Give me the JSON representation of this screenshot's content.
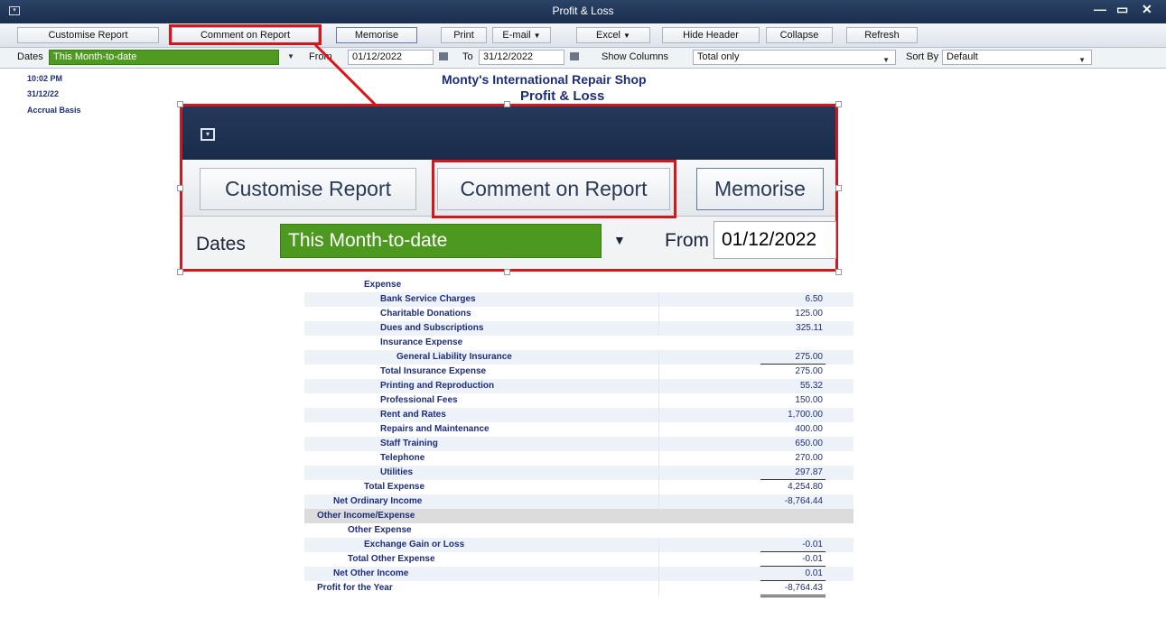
{
  "window": {
    "title": "Profit & Loss",
    "controls": [
      "—",
      "▭",
      "✕"
    ]
  },
  "toolbar": {
    "customise": "Customise Report",
    "comment": "Comment on Report",
    "memorise": "Memorise",
    "print": "Print",
    "email": "E-mail",
    "excel": "Excel",
    "hide_header": "Hide Header",
    "collapse": "Collapse",
    "refresh": "Refresh"
  },
  "filters": {
    "dates_label": "Dates",
    "dates_value": "This Month-to-date",
    "from_label": "From",
    "from_value": "01/12/2022",
    "to_label": "To",
    "to_value": "31/12/2022",
    "show_columns_label": "Show Columns",
    "show_columns_value": "Total only",
    "sort_by_label": "Sort By",
    "sort_by_value": "Default"
  },
  "report": {
    "time": "10:02 PM",
    "date": "31/12/22",
    "basis": "Accrual Basis",
    "company": "Monty's International Repair Shop",
    "title": "Profit & Loss"
  },
  "rows": [
    {
      "label": "Expense",
      "amount": ""
    },
    {
      "label": "Bank Service Charges",
      "amount": "6.50"
    },
    {
      "label": "Charitable Donations",
      "amount": "125.00"
    },
    {
      "label": "Dues and Subscriptions",
      "amount": "325.11"
    },
    {
      "label": "Insurance Expense",
      "amount": ""
    },
    {
      "label": "General Liability Insurance",
      "amount": "275.00"
    },
    {
      "label": "Total Insurance Expense",
      "amount": "275.00"
    },
    {
      "label": "Printing and Reproduction",
      "amount": "55.32"
    },
    {
      "label": "Professional Fees",
      "amount": "150.00"
    },
    {
      "label": "Rent and Rates",
      "amount": "1,700.00"
    },
    {
      "label": "Repairs and Maintenance",
      "amount": "400.00"
    },
    {
      "label": "Staff Training",
      "amount": "650.00"
    },
    {
      "label": "Telephone",
      "amount": "270.00"
    },
    {
      "label": "Utilities",
      "amount": "297.87"
    },
    {
      "label": "Total Expense",
      "amount": "4,254.80"
    },
    {
      "label": "Net Ordinary Income",
      "amount": "-8,764.44"
    },
    {
      "label": "Other Income/Expense",
      "amount": ""
    },
    {
      "label": "Other Expense",
      "amount": ""
    },
    {
      "label": "Exchange Gain or Loss",
      "amount": "-0.01"
    },
    {
      "label": "Total Other Expense",
      "amount": "-0.01"
    },
    {
      "label": "Net Other Income",
      "amount": "0.01"
    },
    {
      "label": "Profit for the Year",
      "amount": "-8,764.43"
    }
  ],
  "colors": {
    "title_bar": "#1a2e4e",
    "dates_field": "#4f9a21",
    "callout": "#d7161c",
    "report_text": "#1d2d7a"
  },
  "icons": {
    "system_menu": "window-menu-icon",
    "calendar": "calendar-icon",
    "dropdown": "chevron-down-icon"
  }
}
